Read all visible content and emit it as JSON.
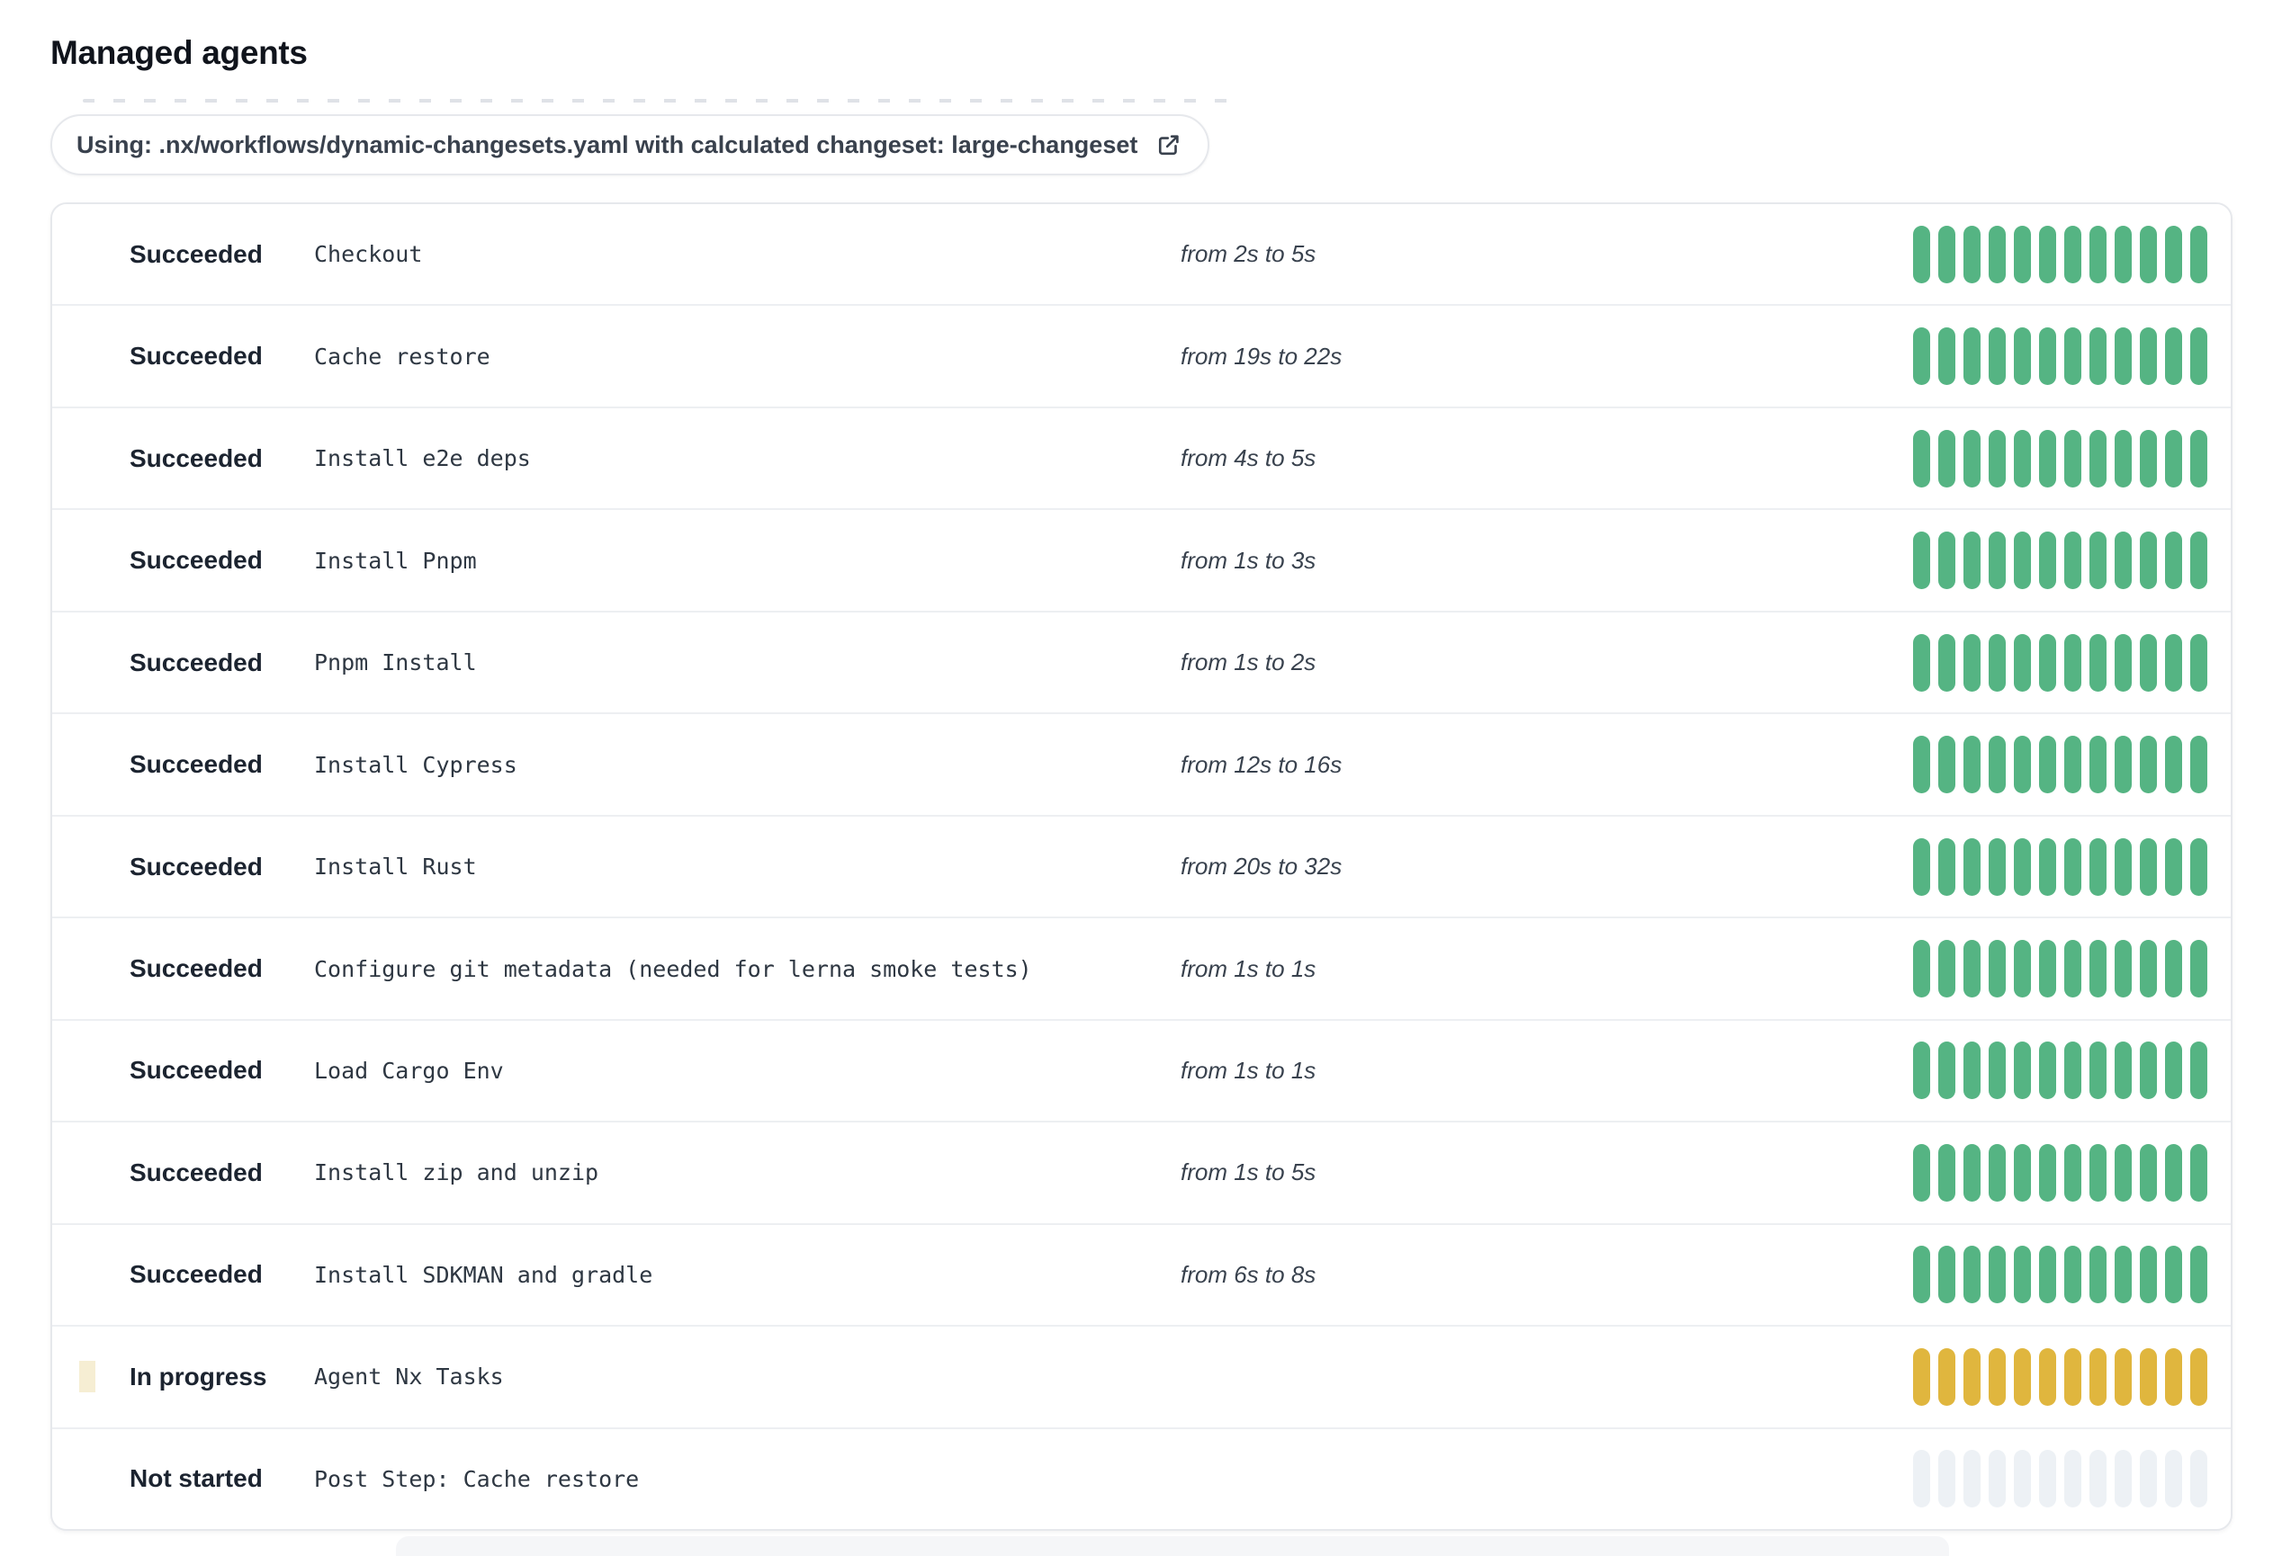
{
  "page": {
    "title": "Managed agents"
  },
  "workflow_pill": {
    "label": "Using: .nx/workflows/dynamic-changesets.yaml with calculated changeset: large-changeset",
    "icon": "external-link-icon"
  },
  "segments_per_row": 12,
  "colors": {
    "succeeded": "#55b483",
    "in_progress": "#e0b63e",
    "in_progress_halo": "#f6eed3",
    "not_started_seg": "#edf1f5",
    "not_started_dot": "#e9eef3"
  },
  "rows": [
    {
      "status": "Succeeded",
      "state": "succeeded",
      "step": "Checkout",
      "duration": "from 2s to 5s"
    },
    {
      "status": "Succeeded",
      "state": "succeeded",
      "step": "Cache restore",
      "duration": "from 19s to 22s"
    },
    {
      "status": "Succeeded",
      "state": "succeeded",
      "step": "Install e2e deps",
      "duration": "from 4s to 5s"
    },
    {
      "status": "Succeeded",
      "state": "succeeded",
      "step": "Install Pnpm",
      "duration": "from 1s to 3s"
    },
    {
      "status": "Succeeded",
      "state": "succeeded",
      "step": "Pnpm Install",
      "duration": "from 1s to 2s"
    },
    {
      "status": "Succeeded",
      "state": "succeeded",
      "step": "Install Cypress",
      "duration": "from 12s to 16s"
    },
    {
      "status": "Succeeded",
      "state": "succeeded",
      "step": "Install Rust",
      "duration": "from 20s to 32s"
    },
    {
      "status": "Succeeded",
      "state": "succeeded",
      "step": "Configure git metadata (needed for lerna smoke tests)",
      "duration": "from 1s to 1s"
    },
    {
      "status": "Succeeded",
      "state": "succeeded",
      "step": "Load Cargo Env",
      "duration": "from 1s to 1s"
    },
    {
      "status": "Succeeded",
      "state": "succeeded",
      "step": "Install zip and unzip",
      "duration": "from 1s to 5s"
    },
    {
      "status": "Succeeded",
      "state": "succeeded",
      "step": "Install SDKMAN and gradle",
      "duration": "from 6s to 8s"
    },
    {
      "status": "In progress",
      "state": "in-progress",
      "step": "Agent Nx Tasks",
      "duration": ""
    },
    {
      "status": "Not started",
      "state": "not-started",
      "step": "Post Step: Cache restore",
      "duration": ""
    }
  ]
}
